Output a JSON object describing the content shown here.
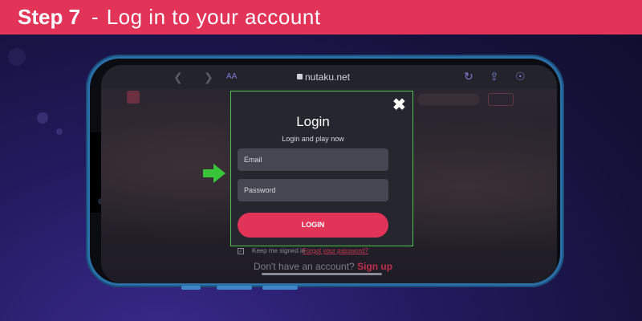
{
  "banner": {
    "step": "Step 7",
    "separator": "-",
    "title": "Log in to your account"
  },
  "browser": {
    "url": "nutaku.net",
    "text_size_label": "AA"
  },
  "modal": {
    "close_label": "✖",
    "title": "Login",
    "subtitle": "Login and play now",
    "email_placeholder": "Email",
    "password_placeholder": "Password",
    "login_button": "LOGIN"
  },
  "page": {
    "keep_signed_in": "Keep me signed in",
    "forgot_password": "Forgot your password?",
    "no_account": "Don't have an account?",
    "sign_up": "Sign up"
  },
  "colors": {
    "accent": "#e23359",
    "highlight": "#4fc44a",
    "phone": "#2a6fa8"
  },
  "icons": [
    "back-icon",
    "forward-icon",
    "lock-icon",
    "reload-icon",
    "share-icon",
    "compass-icon",
    "arrow-right-icon",
    "close-icon",
    "checkbox-icon"
  ]
}
